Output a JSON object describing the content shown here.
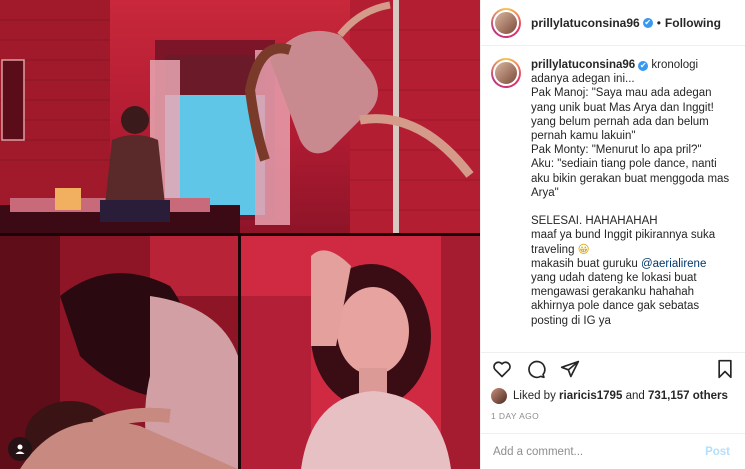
{
  "post": {
    "username": "prillylatuconsina96",
    "verified_mark": "✔",
    "separator": "•",
    "follow_state": "Following"
  },
  "caption": {
    "username": "prillylatuconsina96",
    "lines": [
      "kronologi adanya adegan ini...",
      "Pak Manoj: \"Saya mau ada adegan yang unik buat Mas Arya dan Inggit! yang belum pernah ada dan belum pernah kamu lakuin\"",
      "Pak Monty: \"Menurut lo apa pril?\"",
      "Aku: \"sediain tiang pole dance, nanti aku bikin gerakan buat menggoda mas Arya\"",
      "",
      "SELESAI. HAHAHAHAH",
      "maaf ya bund Inggit pikirannya suka traveling",
      "makasih buat guruku",
      "yang udah dateng ke lokasi buat mengawasi gerakanku hahahah akhirnya pole dance gak sebatas posting di IG ya"
    ],
    "emoji": "😀",
    "mention": "@aerialirene"
  },
  "likes": {
    "prefix": "Liked by",
    "first_user": "riaricis1795",
    "joiner": "and",
    "others": "731,157 others"
  },
  "timestamp": "1 DAY AGO",
  "comment": {
    "placeholder": "Add a comment...",
    "post_label": "Post"
  },
  "icons": {
    "like": "heart-icon",
    "comment": "comment-icon",
    "share": "share-icon",
    "save": "bookmark-icon",
    "user_tag": "user-tag-icon"
  },
  "colors": {
    "verified": "#3897f0",
    "link": "#00376b",
    "post_button": "#b2dffc",
    "photo_tint": "#c8283a"
  }
}
